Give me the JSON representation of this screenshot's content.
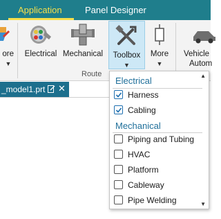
{
  "ribbon_tabs": [
    {
      "label": "Application",
      "active": true
    },
    {
      "label": "Panel Designer",
      "active": false
    }
  ],
  "ribbon": {
    "partial_left_label": "ore",
    "electrical_label": "Electrical",
    "mechanical_label": "Mechanical",
    "toolbox_label": "Toolbox",
    "more_label": "More",
    "vehicle_label_line1": "Vehicle",
    "vehicle_label_line2": "Autom",
    "group_label": "Route"
  },
  "file_tab": {
    "name": "_model1.prt"
  },
  "toolbox_menu": {
    "sections": [
      {
        "title": "Electrical",
        "items": [
          {
            "label": "Harness",
            "checked": true
          },
          {
            "label": "Cabling",
            "checked": true
          }
        ]
      },
      {
        "title": "Mechanical",
        "items": [
          {
            "label": "Piping and Tubing",
            "checked": false
          },
          {
            "label": "HVAC",
            "checked": false
          },
          {
            "label": "Platform",
            "checked": false
          },
          {
            "label": "Cableway",
            "checked": false
          },
          {
            "label": "Pipe Welding",
            "checked": false
          }
        ]
      }
    ]
  },
  "colors": {
    "tab_bar": "#1f7e8c",
    "active_tab": "#f7df4a",
    "file_tab": "#1d6f8d",
    "section_heading": "#1f6f9a",
    "checkbox_check": "#1e6fb0"
  }
}
